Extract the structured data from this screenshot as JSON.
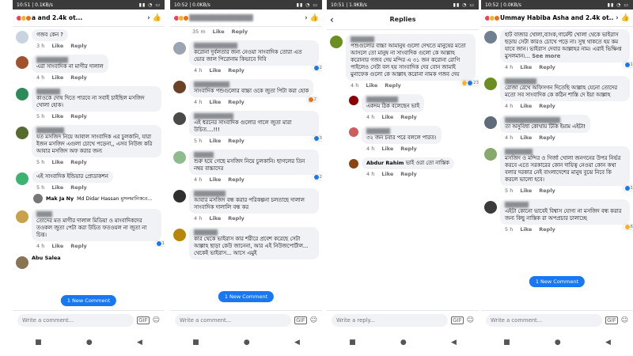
{
  "phones": [
    {
      "status_time": "10:51 | 0.1KB/s",
      "title": "a and 2.4k ot...",
      "comments": [
        {
          "author": "",
          "text": "গজব কেন ?",
          "time": "3 h",
          "like": "Like",
          "reply": "Reply"
        },
        {
          "author": "",
          "text": "এরা সাংবাদিক না মাগীর দালাল",
          "time": "4 h",
          "like": "Like",
          "reply": "Reply"
        },
        {
          "author": "",
          "text": "কাওকে দোষ দিতে পারবে না সবাই চাইছিল মসজিদ খোলা হোক।",
          "time": "5 h",
          "like": "Like",
          "reply": "Reply"
        },
        {
          "author": "",
          "text": "যত মসজিদ নিয়ে আবাল সাংবাদিক এর চুলকানি, যারা ইজন মসজিদ এগুলা চোখে পড়েনা,, এসব নিউজ করি আবার মসজিদ অফ করার জন্য",
          "time": "5 h",
          "like": "Like",
          "reply": "Reply"
        },
        {
          "author": "",
          "text": "এই সাংবাদিক ইন্ডিয়ার প্রোডাকশন",
          "time": "5 h",
          "like": "Like",
          "reply": "Reply"
        },
        {
          "author": "",
          "text": "তোদের মত মাগীর দালাল মিডিয়া ও মাংবাদিকদের তওকল জুতা পেটা করা উচিত ফতওয়ল না জুতা না চিত্ত।",
          "time": "4 h",
          "like": "Like",
          "reply": "Reply",
          "reacts": "1"
        },
        {
          "author": "Abu Salea",
          "text": "",
          "time": "",
          "like": "",
          "reply": ""
        }
      ],
      "reply_preview": {
        "name": "Mak Ja Ny",
        "text": "Md Didar Hassan মুসলমানিকবে..."
      },
      "new_comment": "1 New Comment",
      "composer_placeholder": "Write a comment..."
    },
    {
      "status_time": "10:52 | 0.0KB/s",
      "title": "",
      "comments": [
        {
          "author": "",
          "text": "",
          "time": "35 m",
          "like": "Like",
          "reply": "Reply"
        },
        {
          "author": "",
          "text": "করোনা দুর্বলতার জন্য নেওয়া সাংবাদিক তোরা এত ভোর জাল পিরোনাম কিভাবে দিবি",
          "time": "4 h",
          "like": "Like",
          "reply": "Reply",
          "reacts": "2"
        },
        {
          "author": "",
          "text": "সাংবাদিক পশুগুলোর বাচ্চা ওকে জুতা পিটা করা হোক",
          "time": "4 h",
          "like": "Like",
          "reply": "Reply",
          "reacts": "2"
        },
        {
          "author": "",
          "text": "এই ধরনের সাংবাদিক গুলোর গালে জুতা মারা উচিত....!!!",
          "time": "5 h",
          "like": "Like",
          "reply": "Reply",
          "reacts": "3"
        },
        {
          "author": "",
          "text": "শুরু হয়ে গেছে মসজিদ নিয়ে চুলকানি। ছাগলের তিন নম্বর বাচ্চাদের",
          "time": "4 h",
          "like": "Like",
          "reply": "Reply",
          "reacts": "2"
        },
        {
          "author": "",
          "text": "আবার মসজিদ বন্ধ করার পরিকল্পনা চলতাছে দালাল সাংবাদিক দালালি বন্ধ কর",
          "time": "4 h",
          "like": "Like",
          "reply": "Reply"
        },
        {
          "author": "",
          "text": "কার থেকে ভাইরাস কার শরীরে প্রবেশ করেছে সেটা আল্লাহ ছাড়া কেউ জানেনা, আর এই নিউজপোর্টাল... থেকেই ভাইরাস... আসে এমুই",
          "time": "",
          "like": "",
          "reply": ""
        }
      ],
      "new_comment": "1 New Comment",
      "composer_placeholder": "Write a comment..."
    },
    {
      "status_time": "10:51 | 1.9KB/s",
      "title": "Replies",
      "comments": [
        {
          "author": "",
          "text": "পশুগুলোর বাচ্চা আমানুষ গুলো দেখতে মানুষের মতো আসলে তো মানুষ না সাংবাদিক গুলো কে আল্লাহ করোনার গজব দেয় মন্দির এ ৩১ জন করোনা রোগি পাইলেও সেটা বল হয় সাংবাদিক দের বোন জামাই মুনাফেক গুলো কে আল্লাহ করোনা নামক গজব দেয়",
          "time": "4 h",
          "like": "Like",
          "reply": "Reply",
          "reacts": "23"
        },
        {
          "author": "",
          "text": "একদম ঠিক বলেছেন ভাই",
          "time": "4 h",
          "like": "Like",
          "reply": "Reply"
        },
        {
          "author": "",
          "text": "৩২ জন চবার পরে বললে পারত।",
          "time": "4 h",
          "like": "Like",
          "reply": "Reply"
        },
        {
          "author": "Abdur Rahim",
          "text": "ভাই ওরা তো নাস্তিক",
          "time": "4 h",
          "like": "Like",
          "reply": "Reply"
        }
      ],
      "composer_placeholder": "Write a reply..."
    },
    {
      "status_time": "10:52 | 0.0KB/s",
      "title": "Ummay Habiba Asha and 2.4k ot...",
      "comments": [
        {
          "author": "",
          "text": "হাট বাজার খোলা,ব্যাংক,গার্মেন্ট খোলা থেকে ভাইরাস ছড়ায় সেটা কারও চোখে পড়ে না। সুস্থ থাকতে হয় কম যাবে জান। ভাইরাস দেবার আল্লাহর নাম। এরাই ভিক্ষিপ্ত মুসলমান।...",
          "see_more": "See more",
          "time": "4 h",
          "like": "Like",
          "reply": "Reply",
          "reacts": "1"
        },
        {
          "author": "",
          "text": "রোজা রেখে অফিসগন দিতেছি আল্লাহ যেনো তোদের মতো সব সাংবাদিক কে কঠিন শাস্তি দে ইয়া আল্লাহ",
          "time": "4 h",
          "like": "Like",
          "reply": "Reply"
        },
        {
          "author": "",
          "text": "তা অসুবিধা কোথায় টিকি ইমাম এইটা!",
          "time": "4 h",
          "like": "Like",
          "reply": "Reply"
        },
        {
          "author": "",
          "text": "মসজিদ ও মন্দির ও গির্জা খোলা জনগনের উপর নির্ভর করবে এতে সরকারের কোন দায়িত্ব নেওয়া কোন কথা বলার দরকার নেই বাংলাদেশের মানুষ বুঝে নিবে কি করলে ভালো হবে।",
          "time": "5 h",
          "like": "Like",
          "reply": "Reply",
          "reacts": "1"
        },
        {
          "author": "",
          "text": "এইটা কোনো ভাবেই বিশ্বাস যোগ্য না মসজিদ বন্ধ করার জন্য কিছু নাস্তিক রা অপপ্রচার চালাচ্ছে",
          "time": "5 h",
          "like": "Like",
          "reply": "Reply",
          "reacts": "6"
        }
      ],
      "new_comment": "1 New Comment",
      "composer_placeholder": "Write a comment..."
    }
  ],
  "nav": {
    "recent": "■",
    "home": "●",
    "back": "◀"
  },
  "colors": {
    "fb_blue": "#1877f2",
    "bubble": "#f0f2f5"
  }
}
